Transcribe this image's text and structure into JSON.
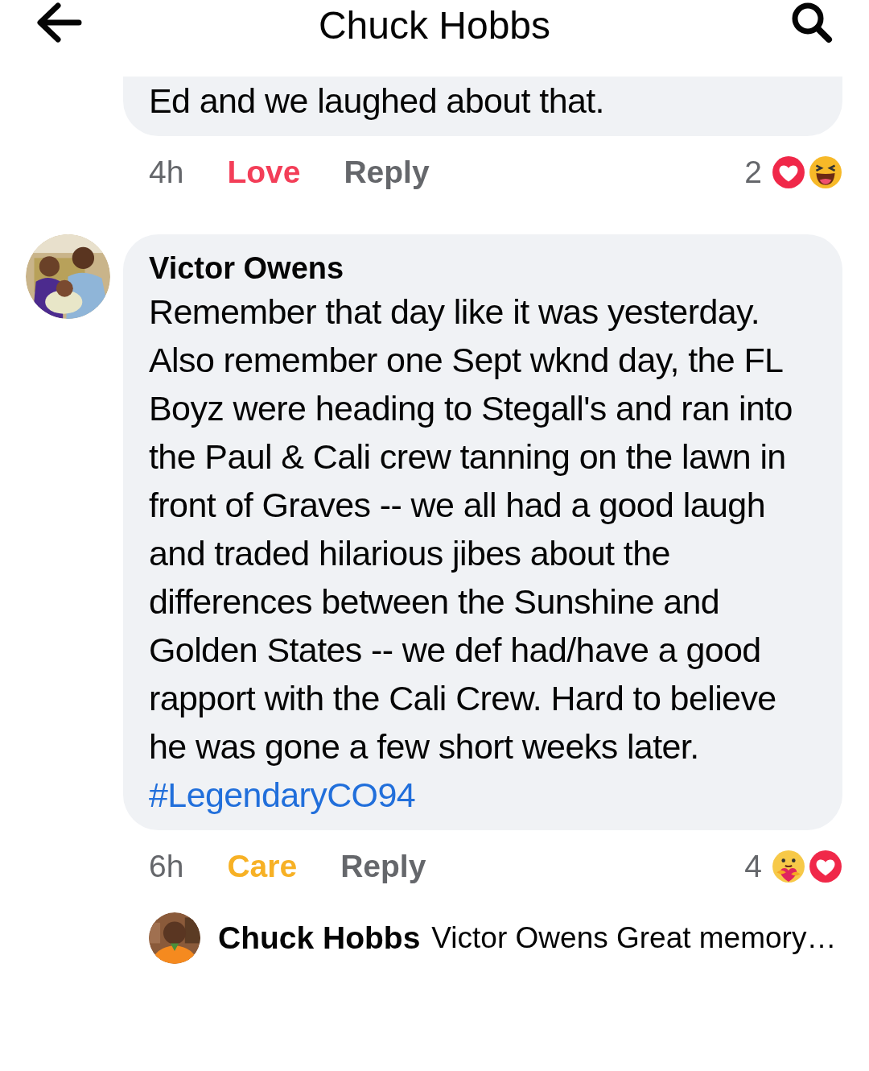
{
  "header": {
    "title": "Chuck Hobbs"
  },
  "comments": [
    {
      "text": "Ed and we laughed about that.",
      "time": "4h",
      "my_reaction": {
        "label": "Love",
        "kind": "love"
      },
      "reply": "Reply",
      "reaction_count": "2",
      "reaction_icons": [
        {
          "kind": "love"
        },
        {
          "kind": "haha"
        }
      ]
    },
    {
      "author": "Victor Owens",
      "text": "Remember that day like it was yesterday. Also remember one Sept wknd day, the FL Boyz were heading to Stegall's and ran into the Paul & Cali crew tanning on the lawn in front of Graves -- we all had a good laugh and traded hilarious jibes about the differences between the Sunshine and Golden States -- we def had/have a good rapport with the Cali Crew. Hard to believe he was gone a few short weeks later.",
      "hashtag": "#LegendaryCO94",
      "time": "6h",
      "my_reaction": {
        "label": "Care",
        "kind": "care"
      },
      "reply": "Reply",
      "reaction_count": "4",
      "reaction_icons": [
        {
          "kind": "care"
        },
        {
          "kind": "love"
        }
      ],
      "reply_preview": {
        "author": "Chuck Hobbs",
        "text": "Victor Owens Great memory…"
      }
    }
  ]
}
